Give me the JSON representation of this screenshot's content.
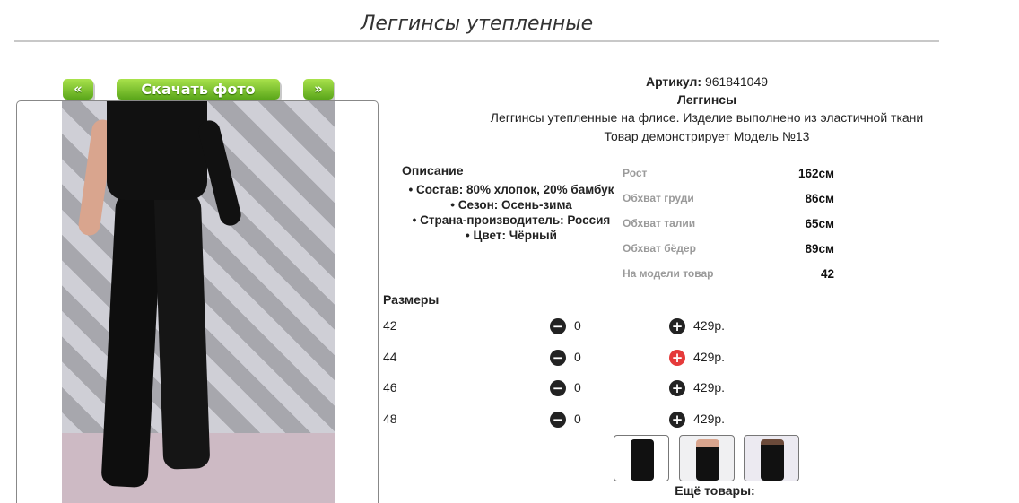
{
  "page": {
    "title": "Леггинсы утепленные"
  },
  "gallery": {
    "prev_label": "«",
    "download_label": "Скачать фото",
    "next_label": "»"
  },
  "product": {
    "article_label": "Артикул:",
    "article_value": "961841049",
    "type": "Леггинсы",
    "description": "Леггинсы утепленные на флисе. Изделие выполнено из эластичной ткани",
    "model_text": "Товар демонстрирует Модель №13"
  },
  "description": {
    "title": "Описание",
    "items": [
      "Состав: 80% хлопок, 20% бамбук",
      "Сезон: Осень-зима",
      "Страна-производитель: Россия",
      "Цвет: Чёрный"
    ]
  },
  "model_params": [
    {
      "label": "Рост",
      "value": "162см"
    },
    {
      "label": "Обхват груди",
      "value": "86см"
    },
    {
      "label": "Обхват талии",
      "value": "65см"
    },
    {
      "label": "Обхват бёдер",
      "value": "89см"
    },
    {
      "label": "На модели товар",
      "value": "42"
    }
  ],
  "sizes": {
    "title": "Размеры",
    "rows": [
      {
        "size": "42",
        "qty": "0",
        "price": "429р."
      },
      {
        "size": "44",
        "qty": "0",
        "price": "429р."
      },
      {
        "size": "46",
        "qty": "0",
        "price": "429р."
      },
      {
        "size": "48",
        "qty": "0",
        "price": "429р."
      }
    ],
    "minus_icon": "−",
    "plus_icon": "+"
  },
  "more_label": "Ещё товары:",
  "colors": {
    "accent_green": "#5aa61a",
    "plus_red": "#e53a3a"
  }
}
